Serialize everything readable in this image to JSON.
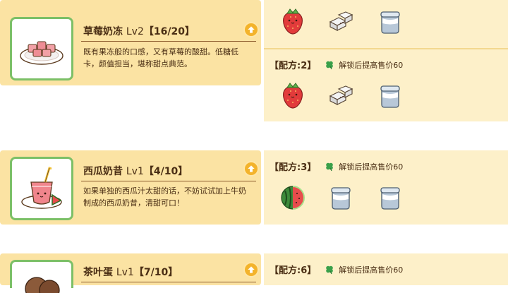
{
  "items": [
    {
      "name": "草莓奶冻",
      "level": "Lv2",
      "progress": "【16/20】",
      "description": "既有果冻般的口感，又有草莓的酸甜。低糖低卡，颜值担当，堪称甜点典范。"
    },
    {
      "name": "西瓜奶昔",
      "level": "Lv1",
      "progress": "【4/10】",
      "description": "如果单独的西瓜汁太甜的话，不妨试试加上牛奶制成的西瓜奶昔，清甜可口！"
    },
    {
      "name": "茶叶蛋",
      "level": "Lv1",
      "progress": "【7/10】",
      "description": ""
    }
  ],
  "recipes": [
    {
      "label": "",
      "note": "",
      "ingredients": [
        "strawberry-icon",
        "sugar-cubes-icon",
        "milk-jar-icon"
      ]
    },
    {
      "label": "【配方:2】",
      "note": "解锁后提高售价60",
      "ingredients": [
        "strawberry-icon",
        "sugar-cubes-icon",
        "milk-jar-icon"
      ]
    },
    {
      "label": "【配方:3】",
      "note": "解锁后提高售价60",
      "ingredients": [
        "watermelon-icon",
        "milk-jar-icon",
        "milk-jar-icon"
      ]
    },
    {
      "label": "【配方:6】",
      "note": "解锁后提高售价60",
      "ingredients": []
    }
  ],
  "colors": {
    "card": "#fbe3a3",
    "panel": "#fdf0c9",
    "thumb_border": "#7cc067",
    "upgrade_button": "#f3b32b"
  }
}
